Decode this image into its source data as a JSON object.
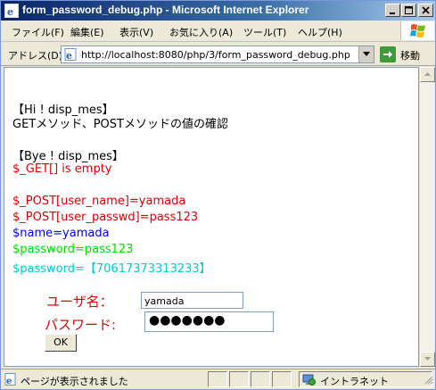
{
  "window": {
    "title": "form_password_debug.php - Microsoft Internet Explorer",
    "accent_color": "#0a246a"
  },
  "menu": {
    "items": [
      {
        "label": "ファイル(F)"
      },
      {
        "label": "編集(E)"
      },
      {
        "label": "表示(V)"
      },
      {
        "label": "お気に入り(A)"
      },
      {
        "label": "ツール(T)"
      },
      {
        "label": "ヘルプ(H)"
      }
    ]
  },
  "address": {
    "label": "アドレス(D)",
    "url": "http://localhost:8080/php/3/form_password_debug.php",
    "go_label": "移動"
  },
  "content": {
    "lines": [
      {
        "text": "【Hi ! disp_mes】",
        "color": "#000000"
      },
      {
        "text": "GETメソッド、POSTメソッドの値の確認",
        "color": "#000000"
      },
      {
        "text": "【Bye ! disp_mes】",
        "color": "#000000"
      },
      {
        "text": "$_GET[] is empty",
        "color": "#e00000"
      },
      {
        "text": "$_POST[user_name]=yamada",
        "color": "#e00000"
      },
      {
        "text": "$_POST[user_passwd]=pass123",
        "color": "#e00000"
      },
      {
        "text": "$name=yamada",
        "color": "#0000ee"
      },
      {
        "text": "$password=pass123",
        "color": "#00dd00"
      },
      {
        "text": "$password=【70617373313233】",
        "color": "#00cccc"
      }
    ],
    "form": {
      "username_label": "ユーザ名：",
      "username_value": "yamada",
      "password_label": "パスワード:",
      "password_masked": "●●●●●●●",
      "ok_label": "OK"
    }
  },
  "status": {
    "text": "ページが表示されました",
    "zone": "イントラネット"
  }
}
